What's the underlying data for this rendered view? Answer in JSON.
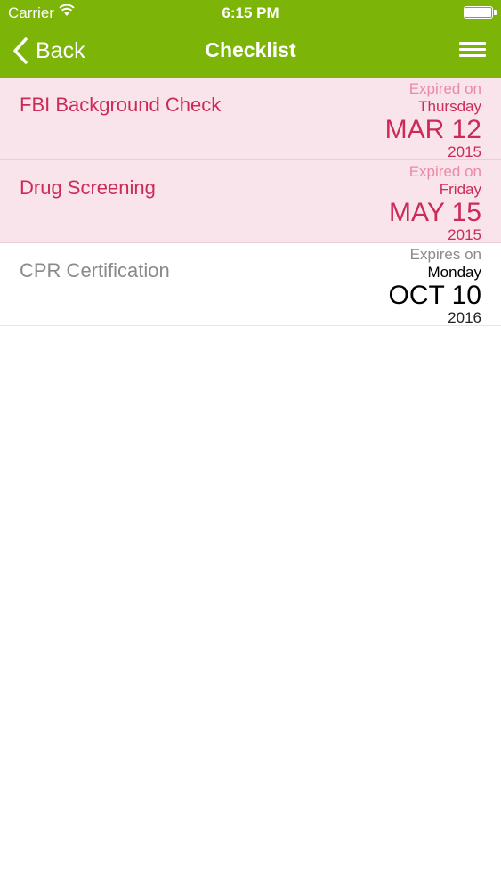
{
  "status_bar": {
    "carrier": "Carrier",
    "time": "6:15 PM"
  },
  "nav": {
    "back_label": "Back",
    "title": "Checklist"
  },
  "colors": {
    "nav_background": "#7cb407",
    "expired_row": "#f8e4ea",
    "expired_text": "#cc2b5a"
  },
  "items": [
    {
      "name": "FBI Background Check",
      "status": "Expired on",
      "weekday": "Thursday",
      "date": "MAR 12",
      "year": "2015",
      "state": "expired"
    },
    {
      "name": "Drug Screening",
      "status": "Expired on",
      "weekday": "Friday",
      "date": "MAY 15",
      "year": "2015",
      "state": "expired"
    },
    {
      "name": "CPR Certification",
      "status": "Expires on",
      "weekday": "Monday",
      "date": "OCT 10",
      "year": "2016",
      "state": "valid"
    }
  ]
}
